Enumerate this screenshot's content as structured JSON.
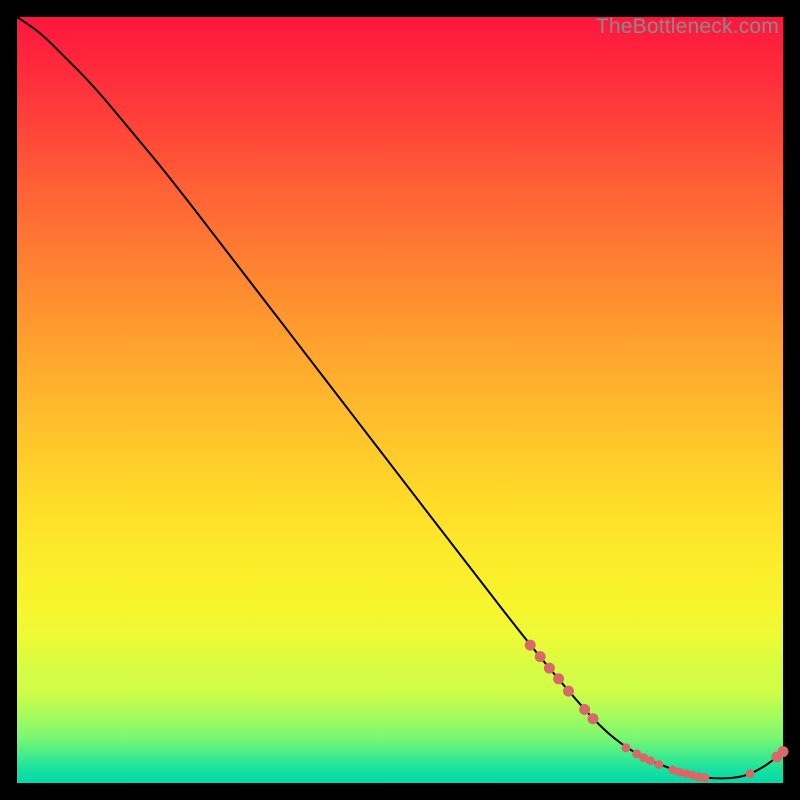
{
  "watermark": "TheBottleneck.com",
  "chart_data": {
    "type": "line",
    "title": "",
    "xlabel": "",
    "ylabel": "",
    "xlim": [
      0,
      100
    ],
    "ylim": [
      0,
      100
    ],
    "series": [
      {
        "name": "curve",
        "x": [
          0,
          3,
          6,
          10,
          15,
          20,
          30,
          40,
          50,
          60,
          67,
          72,
          76,
          79,
          82,
          85,
          87,
          89,
          91,
          93,
          95,
          97,
          99,
          100
        ],
        "y": [
          100,
          98,
          95,
          91,
          85,
          79,
          66,
          53,
          40,
          27,
          18,
          12,
          7.5,
          5,
          3.2,
          2,
          1.3,
          0.8,
          0.6,
          0.6,
          0.9,
          1.8,
          3.2,
          4.1
        ],
        "stroke": "#000000",
        "stroke_width": 2
      }
    ],
    "highlight_points": {
      "color": "#d66a6a",
      "radius_small": 4.5,
      "radius_large": 5.5,
      "points": [
        {
          "x": 67.0,
          "y": 18.0,
          "r": "l"
        },
        {
          "x": 68.3,
          "y": 16.5,
          "r": "l"
        },
        {
          "x": 69.5,
          "y": 15.0,
          "r": "l"
        },
        {
          "x": 70.7,
          "y": 13.6,
          "r": "l"
        },
        {
          "x": 72.0,
          "y": 12.0,
          "r": "l"
        },
        {
          "x": 74.1,
          "y": 9.6,
          "r": "l"
        },
        {
          "x": 75.2,
          "y": 8.4,
          "r": "l"
        },
        {
          "x": 79.5,
          "y": 4.6,
          "r": "s"
        },
        {
          "x": 80.9,
          "y": 3.8,
          "r": "s"
        },
        {
          "x": 81.8,
          "y": 3.3,
          "r": "s"
        },
        {
          "x": 82.7,
          "y": 2.9,
          "r": "s"
        },
        {
          "x": 83.8,
          "y": 2.4,
          "r": "s"
        },
        {
          "x": 85.6,
          "y": 1.7,
          "r": "s"
        },
        {
          "x": 86.5,
          "y": 1.4,
          "r": "s"
        },
        {
          "x": 87.4,
          "y": 1.2,
          "r": "s"
        },
        {
          "x": 88.2,
          "y": 1.0,
          "r": "s"
        },
        {
          "x": 89.0,
          "y": 0.8,
          "r": "s"
        },
        {
          "x": 89.8,
          "y": 0.7,
          "r": "s"
        },
        {
          "x": 95.7,
          "y": 1.2,
          "r": "s"
        },
        {
          "x": 99.2,
          "y": 3.4,
          "r": "l"
        },
        {
          "x": 100.0,
          "y": 4.1,
          "r": "l"
        }
      ]
    },
    "background_gradient": {
      "top": "#ff163e",
      "mid": "#ffdb29",
      "bottom": "#00d9ab"
    }
  }
}
